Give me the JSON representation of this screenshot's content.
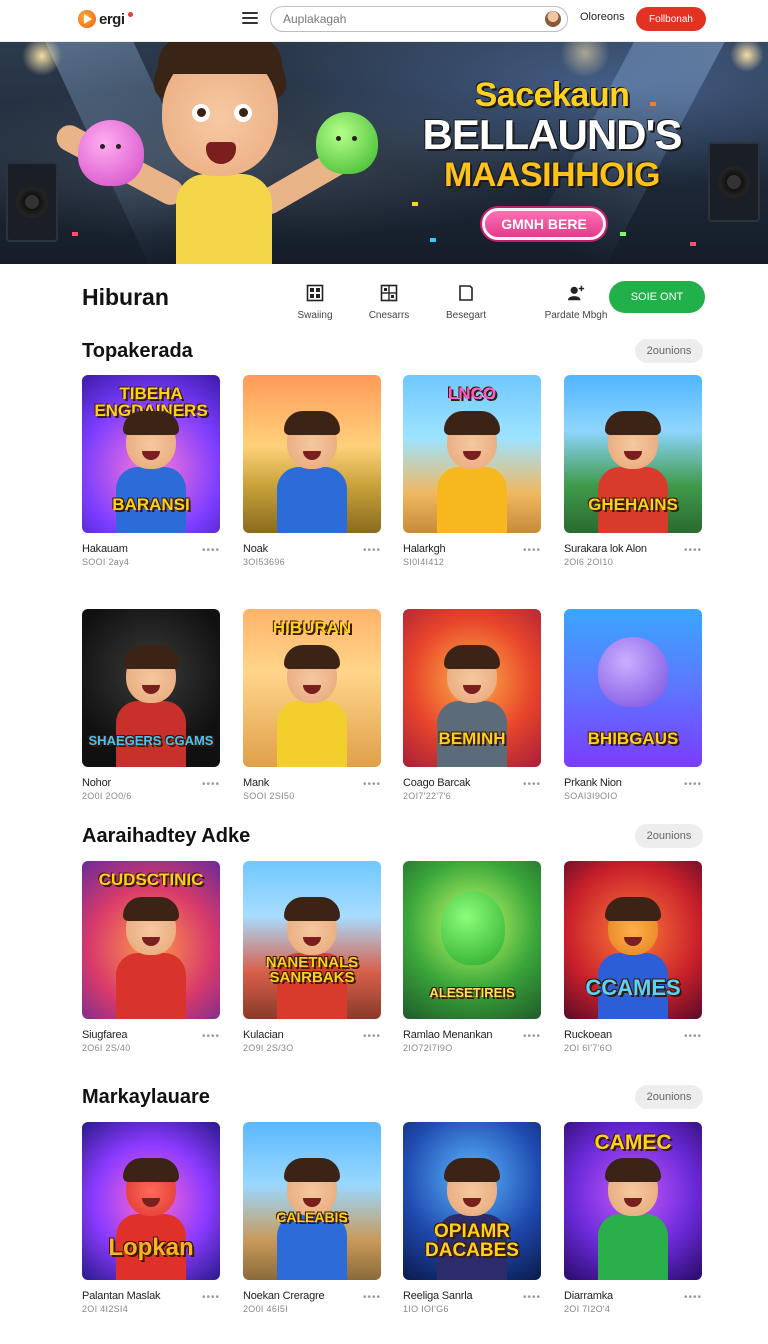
{
  "header": {
    "logo_text": "ergi",
    "search_placeholder": "Auplakagah",
    "link_label": "Oloreons",
    "cta_label": "Follbonah"
  },
  "hero": {
    "line1": "Sacekaun",
    "line2": "BELLAUND'S",
    "line3": "MAASIHHOIG",
    "cta_label": "GMNH BERE"
  },
  "categories": {
    "title": "Hiburan",
    "items": [
      {
        "label": "Swaiing",
        "icon": "grid-icon"
      },
      {
        "label": "Cnesarrs",
        "icon": "grid-icon"
      },
      {
        "label": "Besegart",
        "icon": "bookmark-icon"
      },
      {
        "label": "Pardate Mbgh",
        "icon": "user-plus-icon"
      }
    ],
    "cta_label": "SOIE ONT"
  },
  "sections": [
    {
      "title": "Topakerada",
      "see_all": "2ounions",
      "rows": [
        [
          {
            "name": "Hakauam",
            "sub": "SOOI 2ay4",
            "art_top": "TIBEHA ENGDAINERS",
            "art_bottom": "BARANSI"
          },
          {
            "name": "Noak",
            "sub": "3OI53696",
            "art_top": "",
            "art_bottom": ""
          },
          {
            "name": "Halarkgh",
            "sub": "SI0I4I412",
            "art_top": "LNCO",
            "art_bottom": ""
          },
          {
            "name": "Surakara lok Alon",
            "sub": "2Ol6 2OI10",
            "art_top": "",
            "art_bottom": "GHEHAINS"
          }
        ],
        [
          {
            "name": "Nohor",
            "sub": "2O0I 2O0/6",
            "art_top": "",
            "art_bottom": "SHAEGERS CGAMS"
          },
          {
            "name": "Mank",
            "sub": "SOOI 2SI50",
            "art_top": "HIBURAN",
            "art_bottom": ""
          },
          {
            "name": "Coago Barcak",
            "sub": "2OI7'22'7'6",
            "art_top": "",
            "art_bottom": "BEMINH"
          },
          {
            "name": "Prkank Nion",
            "sub": "SOAI3I9OIO",
            "art_top": "",
            "art_bottom": "BHIBGAUS"
          }
        ]
      ]
    },
    {
      "title": "Aaraihadtey Adke",
      "see_all": "2ounions",
      "rows": [
        [
          {
            "name": "Siugfarea",
            "sub": "2O6I 2S/40",
            "art_top": "CUDSCTINIC",
            "art_bottom": ""
          },
          {
            "name": "Kulacian",
            "sub": "2O9I 2S/3O",
            "art_top": "",
            "art_bottom": "NANETNALS SANRBAKS"
          },
          {
            "name": "Ramlao Menankan",
            "sub": "2IO72I7I9O",
            "art_top": "",
            "art_bottom": "ALESETIREIS"
          },
          {
            "name": "Ruckoean",
            "sub": "2OI 6I'7'6O",
            "art_top": "",
            "art_bottom": "CCAMES"
          }
        ]
      ]
    },
    {
      "title": "Markaylauare",
      "see_all": "2ounions",
      "rows": [
        [
          {
            "name": "Palantan Maslak",
            "sub": "2OI 4I2SI4",
            "art_top": "",
            "art_bottom": "Lopkan"
          },
          {
            "name": "Noekan Creragre",
            "sub": "2O0I 46I5I",
            "art_top": "",
            "art_bottom": "CALEABIS"
          },
          {
            "name": "Reeliga Sanrla",
            "sub": "1IO IOI'G6",
            "art_top": "",
            "art_bottom": "OPIAMR DACABES"
          },
          {
            "name": "Diarramka",
            "sub": "2OI 7I2O'4",
            "art_top": "CAMEC",
            "art_bottom": ""
          }
        ]
      ]
    }
  ],
  "more_glyph": "••••"
}
